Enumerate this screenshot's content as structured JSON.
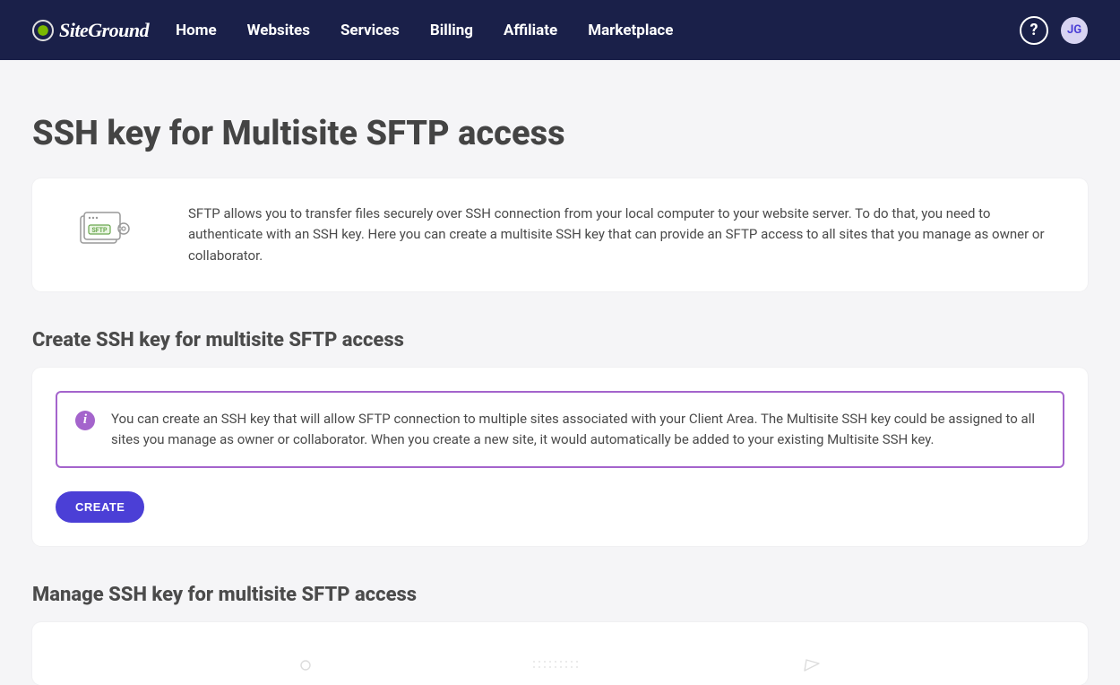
{
  "brand": "SiteGround",
  "nav": {
    "items": [
      {
        "label": "Home"
      },
      {
        "label": "Websites"
      },
      {
        "label": "Services"
      },
      {
        "label": "Billing"
      },
      {
        "label": "Affiliate"
      },
      {
        "label": "Marketplace"
      }
    ]
  },
  "help_symbol": "?",
  "avatar_initials": "JG",
  "page": {
    "title": "SSH key for Multisite SFTP access",
    "intro_text": "SFTP allows you to transfer files securely over SSH connection from your local computer to your website server. To do that, you need to authenticate with an SSH key. Here you can create a multisite SSH key that can provide an SFTP access to all sites that you manage as owner or collaborator."
  },
  "create": {
    "heading": "Create SSH key for multisite SFTP access",
    "info_text": "You can create an SSH key that will allow SFTP connection to multiple sites associated with your Client Area. The Multisite SSH key could be assigned to all sites you manage as owner or collaborator. When you create a new site, it would automatically be added to your existing Multisite SSH key.",
    "button_label": "CREATE"
  },
  "manage": {
    "heading": "Manage SSH key for multisite SFTP access"
  },
  "sftp_badge_label": "SFTP"
}
